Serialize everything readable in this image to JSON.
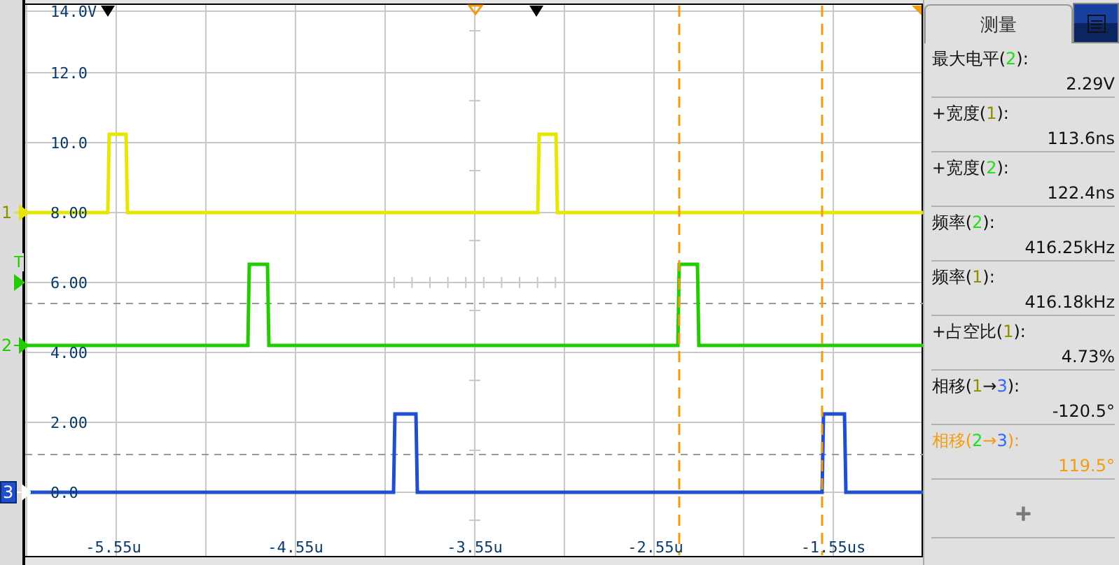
{
  "channels": [
    {
      "label": "1",
      "color": "#e6e600"
    },
    {
      "label": "2",
      "color": "#22cc00"
    },
    {
      "label": "3",
      "color": "#1f4fd0"
    }
  ],
  "trigger_marker": {
    "label": "T"
  },
  "y_axis_labels": [
    "14.0V",
    "12.0",
    "10.0",
    "8.00",
    "6.00",
    "4.00",
    "2.00",
    "0.0"
  ],
  "x_axis_labels": [
    "-5.55u",
    "-4.55u",
    "-3.55u",
    "-2.55u",
    "-1.55us"
  ],
  "panel": {
    "tab": {
      "label": "测量",
      "selected": true
    },
    "measurements": [
      {
        "parts": [
          {
            "text": "最大电平("
          },
          {
            "text": "2",
            "color": "#22dd22"
          },
          {
            "text": "):"
          }
        ],
        "value": "2.29V",
        "selected": false
      },
      {
        "parts": [
          {
            "text": "+宽度("
          },
          {
            "text": "1",
            "color": "#8f8f00"
          },
          {
            "text": "):"
          }
        ],
        "value": "113.6ns",
        "selected": false
      },
      {
        "parts": [
          {
            "text": "+宽度("
          },
          {
            "text": "2",
            "color": "#22dd22"
          },
          {
            "text": "):"
          }
        ],
        "value": "122.4ns",
        "selected": false
      },
      {
        "parts": [
          {
            "text": "频率("
          },
          {
            "text": "2",
            "color": "#22dd22"
          },
          {
            "text": "):"
          }
        ],
        "value": "416.25kHz",
        "selected": false
      },
      {
        "parts": [
          {
            "text": "频率("
          },
          {
            "text": "1",
            "color": "#8f8f00"
          },
          {
            "text": "):"
          }
        ],
        "value": "416.18kHz",
        "selected": false
      },
      {
        "parts": [
          {
            "text": "+占空比("
          },
          {
            "text": "1",
            "color": "#8f8f00"
          },
          {
            "text": "):"
          }
        ],
        "value": "4.73%",
        "selected": false
      },
      {
        "parts": [
          {
            "text": "相移("
          },
          {
            "text": "1",
            "color": "#8f8f00"
          },
          {
            "text": "→"
          },
          {
            "text": "3",
            "color": "#3366ff"
          },
          {
            "text": "):"
          }
        ],
        "value": "-120.5°",
        "selected": false
      },
      {
        "parts": [
          {
            "text": "相移("
          },
          {
            "text": "2",
            "color": "#22dd22"
          },
          {
            "text": "→"
          },
          {
            "text": "3",
            "color": "#3366ff"
          },
          {
            "text": "):"
          }
        ],
        "value": "119.5°",
        "selected": true
      }
    ],
    "add_button": "+"
  }
}
